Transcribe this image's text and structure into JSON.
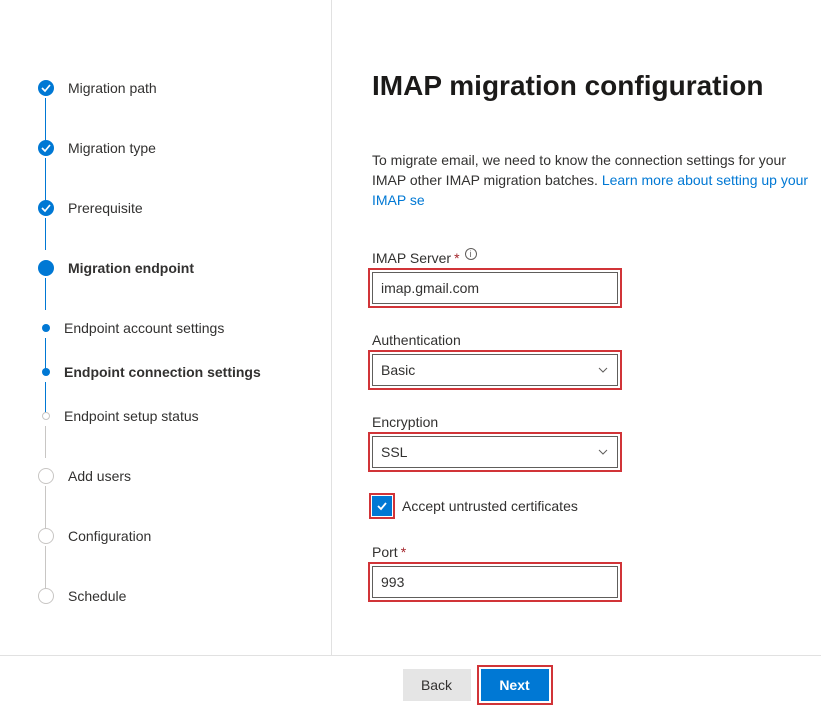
{
  "sidebar": {
    "steps": [
      {
        "label": "Migration path"
      },
      {
        "label": "Migration type"
      },
      {
        "label": "Prerequisite"
      },
      {
        "label": "Migration endpoint"
      },
      {
        "label": "Endpoint account settings"
      },
      {
        "label": "Endpoint connection settings"
      },
      {
        "label": "Endpoint setup status"
      },
      {
        "label": "Add users"
      },
      {
        "label": "Configuration"
      },
      {
        "label": "Schedule"
      }
    ]
  },
  "main": {
    "title": "IMAP migration configuration",
    "description_part1": "To migrate email, we need to know the connection settings for your IMAP",
    "description_part2": " other IMAP migration batches. ",
    "description_link": "Learn more about setting up your IMAP se",
    "fields": {
      "server_label": "IMAP Server",
      "server_value": "imap.gmail.com",
      "auth_label": "Authentication",
      "auth_value": "Basic",
      "enc_label": "Encryption",
      "enc_value": "SSL",
      "cert_label": "Accept untrusted certificates",
      "port_label": "Port",
      "port_value": "993"
    }
  },
  "footer": {
    "back": "Back",
    "next": "Next"
  }
}
